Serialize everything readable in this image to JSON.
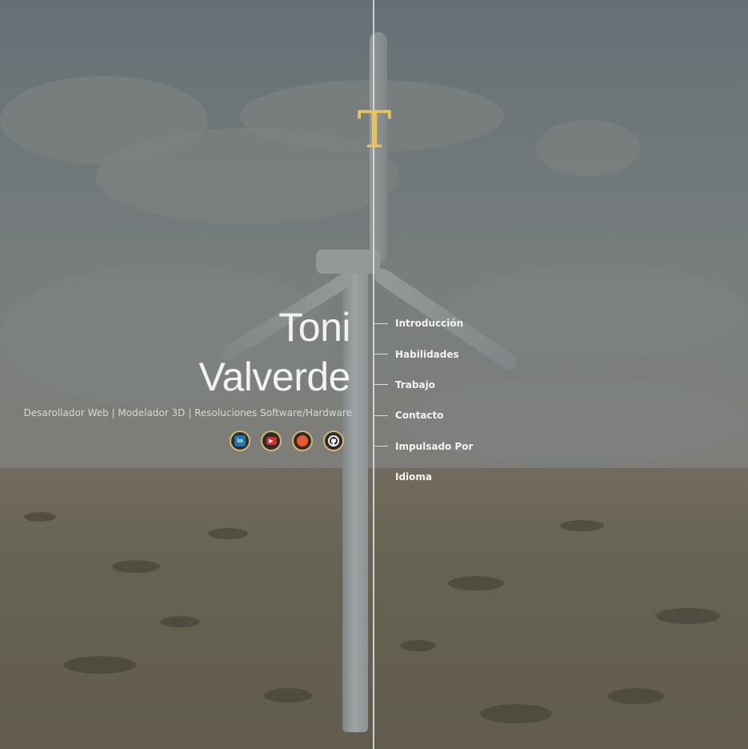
{
  "logo": {
    "letter": "T",
    "color": "#e7c35e"
  },
  "profile": {
    "name_line1": "Toni",
    "name_line2": "Valverde",
    "subtitle": "Desarollador Web | Modelador 3D | Resoluciones Software/Hardware"
  },
  "social": [
    {
      "name": "LinkedIn",
      "icon": "linkedin-icon",
      "glyph": "in"
    },
    {
      "name": "YouTube",
      "icon": "youtube-icon",
      "glyph": "▶"
    },
    {
      "name": "Reddit",
      "icon": "reddit-icon",
      "glyph": "●"
    },
    {
      "name": "GitHub",
      "icon": "github-icon",
      "glyph": "●"
    }
  ],
  "nav": {
    "items": [
      {
        "label": "Introducción"
      },
      {
        "label": "Habilidades"
      },
      {
        "label": "Trabajo"
      },
      {
        "label": "Contacto"
      },
      {
        "label": "Impulsado Por"
      },
      {
        "label": "Idioma"
      }
    ]
  },
  "colors": {
    "accent": "#e7c35e",
    "text": "#f3f3f3",
    "divider": "#d9dbd9"
  }
}
